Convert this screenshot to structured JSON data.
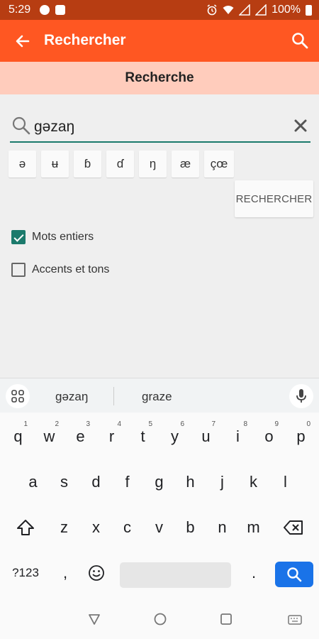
{
  "status_bar": {
    "time": "5:29",
    "battery": "100%"
  },
  "app_bar": {
    "title": "Rechercher"
  },
  "sub_header": {
    "title": "Recherche"
  },
  "search": {
    "query": "gəzaŋ"
  },
  "special_chars": [
    "ə",
    "ʉ",
    "ɓ",
    "ɗ",
    "ŋ",
    "æ",
    "çœ"
  ],
  "search_button": {
    "label": "RECHERCHER"
  },
  "options": {
    "whole_words": {
      "label": "Mots entiers",
      "checked": true
    },
    "accents": {
      "label": "Accents et tons",
      "checked": false
    }
  },
  "keyboard": {
    "suggestions": [
      "gəzaŋ",
      "graze"
    ],
    "row1": [
      {
        "key": "q",
        "hint": "1"
      },
      {
        "key": "w",
        "hint": "2"
      },
      {
        "key": "e",
        "hint": "3"
      },
      {
        "key": "r",
        "hint": "4"
      },
      {
        "key": "t",
        "hint": "5"
      },
      {
        "key": "y",
        "hint": "6"
      },
      {
        "key": "u",
        "hint": "7"
      },
      {
        "key": "i",
        "hint": "8"
      },
      {
        "key": "o",
        "hint": "9"
      },
      {
        "key": "p",
        "hint": "0"
      }
    ],
    "row2": [
      "a",
      "s",
      "d",
      "f",
      "g",
      "h",
      "j",
      "k",
      "l"
    ],
    "row3": [
      "z",
      "x",
      "c",
      "v",
      "b",
      "n",
      "m"
    ],
    "symbols_label": "?123",
    "comma": ",",
    "period": "."
  },
  "colors": {
    "status_bar": "#b73d12",
    "app_bar": "#ff5722",
    "sub_header": "#ffccbc",
    "accent": "#1b7a6c",
    "enter_key": "#1a73e8"
  }
}
